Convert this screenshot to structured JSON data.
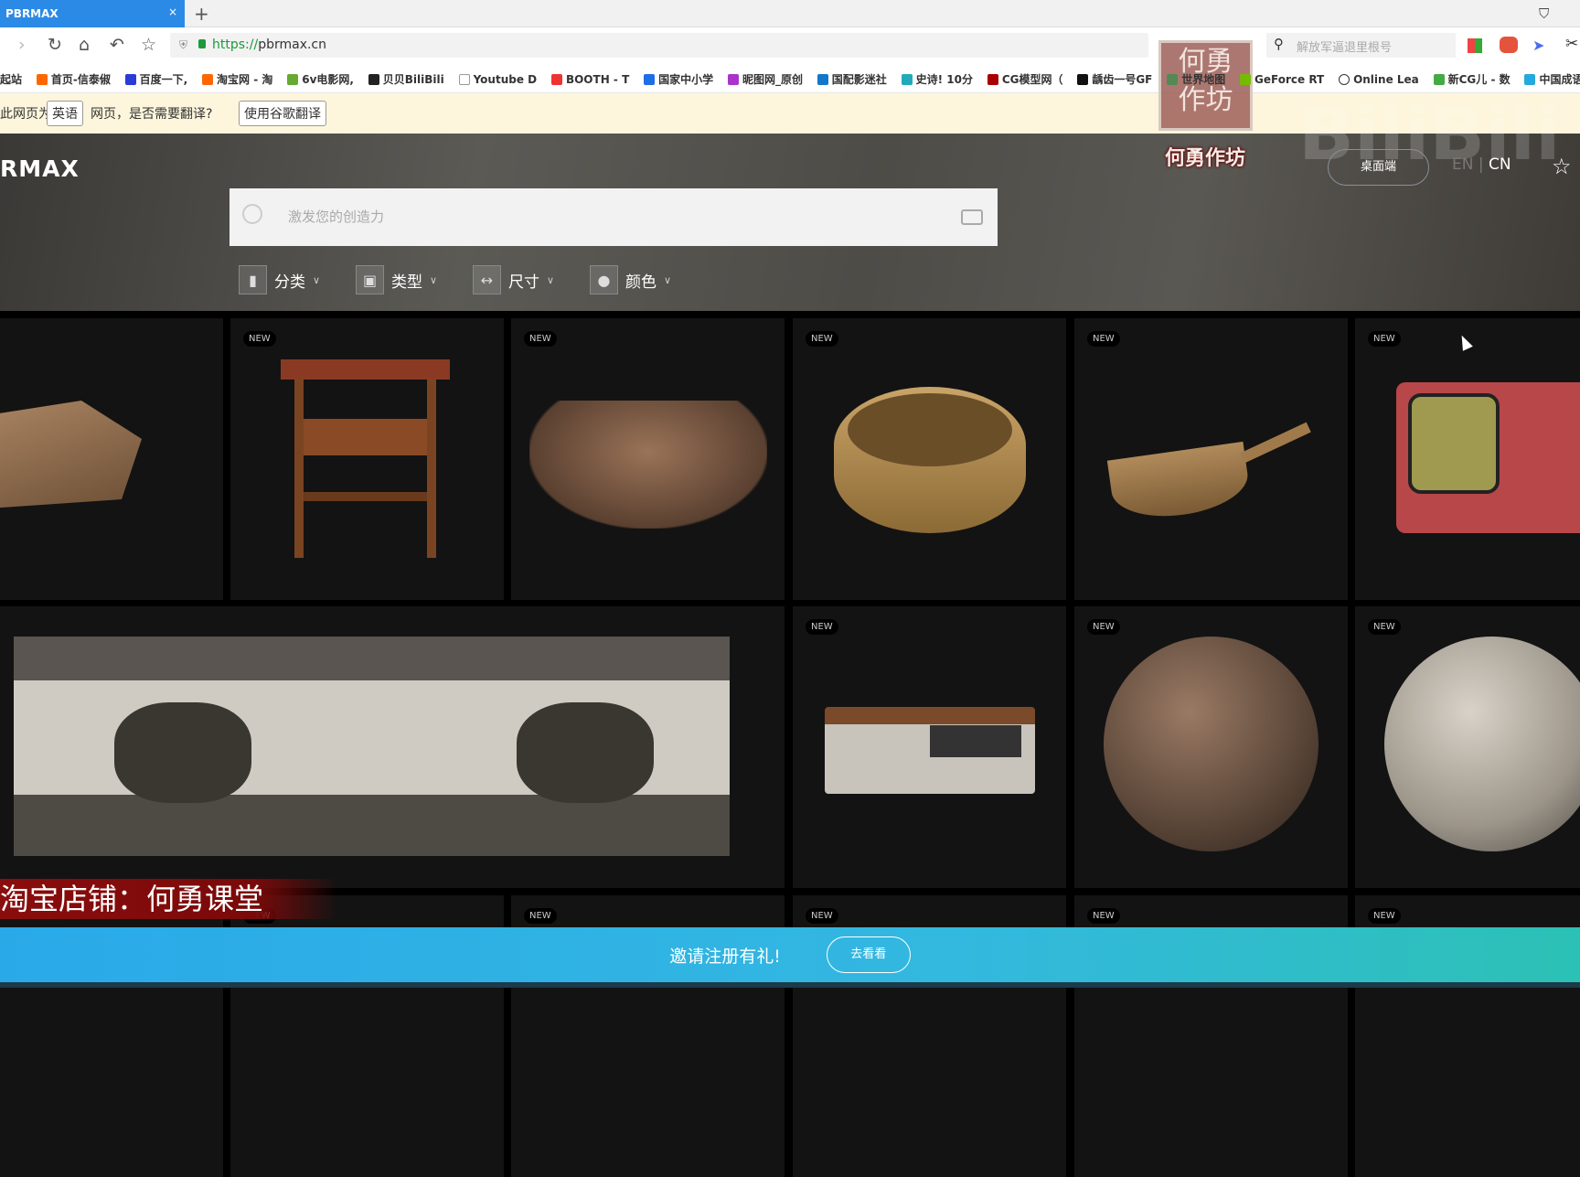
{
  "browser": {
    "tab_title": "PBRMAX",
    "tab_close": "×",
    "new_tab": "+",
    "url_scheme": "https://",
    "url_host": "pbrmax.cn",
    "search_placeholder": "解放军逼退里根号",
    "bookmarks": [
      "起站",
      "首页-信泰俶",
      "百度一下,",
      "淘宝网 - 淘",
      "6v电影网,",
      "贝贝BiliBili",
      "Youtube D",
      "BOOTH - T",
      "国家中小学",
      "昵图网_原创",
      "国配影迷社",
      "史诗! 10分",
      "CG模型网（",
      "龋齿一号GF",
      "世界地图",
      "GeForce RT",
      "Online Lea",
      "新CG儿 - 数",
      "中国成语"
    ],
    "translate": {
      "prefix": "此网页为",
      "lang": "英语",
      "suffix": "网页，是否需要翻译?",
      "button": "使用谷歌翻译"
    }
  },
  "site": {
    "logo": "RMAX",
    "search_placeholder": "激发您的创造力",
    "filters": [
      {
        "label": "分类",
        "icon": "book-icon"
      },
      {
        "label": "类型",
        "icon": "shapes-icon"
      },
      {
        "label": "尺寸",
        "icon": "ruler-icon"
      },
      {
        "label": "颜色",
        "icon": "color-ball-icon"
      }
    ],
    "desktop_button": "桌面端",
    "lang_en": "EN",
    "lang_sep": "|",
    "lang_cn": "CN",
    "badge": "NEW",
    "tiles": [
      {
        "name": "rock"
      },
      {
        "name": "wooden-side-table"
      },
      {
        "name": "dirt-pile"
      },
      {
        "name": "bamboo-steamer"
      },
      {
        "name": "wooden-scoop"
      },
      {
        "name": "red-retro-tv"
      },
      {
        "name": "carved-stone-panel"
      },
      {
        "name": "vintage-radio"
      },
      {
        "name": "rubble-sphere"
      },
      {
        "name": "stone-sphere"
      }
    ],
    "invite_text": "邀请注册有礼!",
    "invite_button": "去看看"
  },
  "overlay": {
    "watermark_stamp": "何勇作坊",
    "watermark_name": "何勇作坊",
    "promo": "淘宝店铺：何勇课堂"
  },
  "colors": {
    "tab": "#2b8ae6",
    "banner_start": "#2aa9e9",
    "banner_end": "#2cc1b5",
    "promo": "#8a0d0d"
  }
}
